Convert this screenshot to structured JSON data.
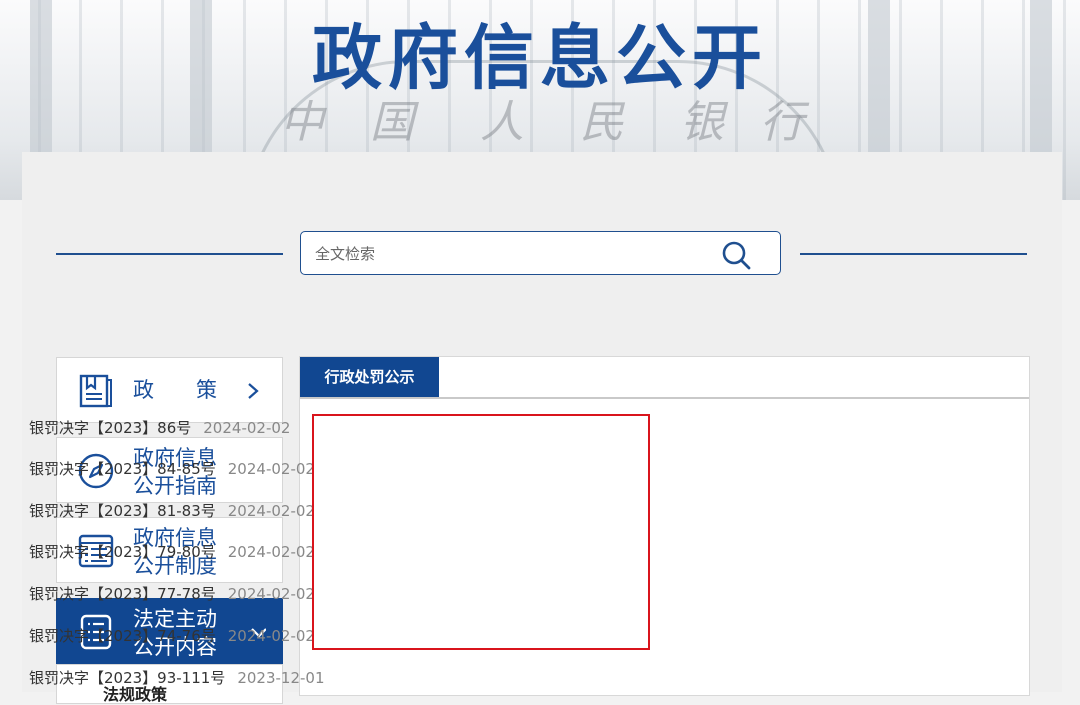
{
  "header": {
    "title": "政府信息公开",
    "watermark_chars": [
      "中",
      "国",
      "人",
      "民",
      "银",
      "行"
    ],
    "title_color": "#1a4f9b"
  },
  "search": {
    "placeholder": "全文检索",
    "icon": "search-icon"
  },
  "sidebar": {
    "items": [
      {
        "label_line1": "政　　策",
        "label_line2": "",
        "icon": "book-icon",
        "chevron": "chevron-right-icon",
        "active": false
      },
      {
        "label_line1": "政府信息",
        "label_line2": "公开指南",
        "icon": "compass-icon",
        "chevron": "",
        "active": false
      },
      {
        "label_line1": "政府信息",
        "label_line2": "公开制度",
        "icon": "list-document-icon",
        "chevron": "",
        "active": false
      },
      {
        "label_line1": "法定主动",
        "label_line2": "公开内容",
        "icon": "notebook-icon",
        "chevron": "chevron-down-icon",
        "active": true
      }
    ],
    "sub_items": [
      {
        "label": "法规政策"
      }
    ],
    "active_color": "#114791"
  },
  "main": {
    "tabs": [
      {
        "label": "行政处罚公示",
        "active": true
      }
    ],
    "items": [
      {
        "title": "银罚决字【2023】86号",
        "date": "2024-02-02"
      },
      {
        "title": "银罚决字【2023】84-85号",
        "date": "2024-02-02"
      },
      {
        "title": "银罚决字【2023】81-83号",
        "date": "2024-02-02"
      },
      {
        "title": "银罚决字【2023】79-80号",
        "date": "2024-02-02"
      },
      {
        "title": "银罚决字【2023】77-78号",
        "date": "2024-02-02"
      },
      {
        "title": "银罚决字【2023】74-76号",
        "date": "2024-02-02"
      },
      {
        "title": "银罚决字【2023】93-111号",
        "date": "2023-12-01"
      }
    ],
    "highlight_color": "#d9141c"
  }
}
